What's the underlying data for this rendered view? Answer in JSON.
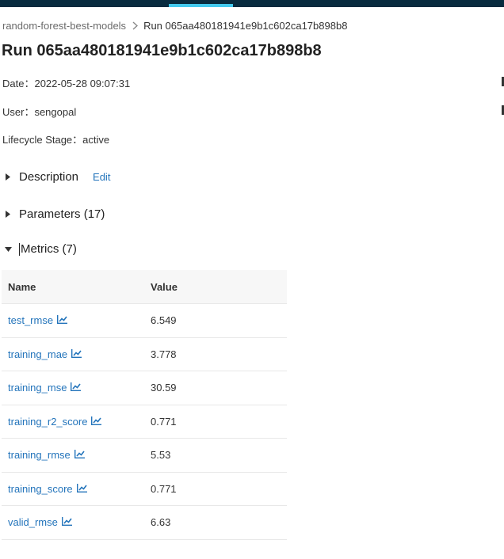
{
  "colors": {
    "topbar": "#082b3f",
    "active_tab_indicator": "#43c9ed",
    "link": "#2374bb"
  },
  "breadcrumb": {
    "parent": "random-forest-best-models",
    "separator_icon": "chevron-right-icon",
    "current": "Run 065aa480181941e9b1c602ca17b898b8"
  },
  "title": "Run 065aa480181941e9b1c602ca17b898b8",
  "meta": {
    "date_label": "Date：",
    "date_value": "2022-05-28 09:07:31",
    "user_label": "User：",
    "user_value": "sengopal",
    "stage_label": "Lifecycle Stage：",
    "stage_value": "active"
  },
  "sections": {
    "description": {
      "label": "Description",
      "edit": "Edit",
      "expanded": false
    },
    "parameters": {
      "label": "Parameters (17)",
      "expanded": false
    },
    "metrics": {
      "label": "Metrics (7)",
      "expanded": true
    }
  },
  "metrics_table": {
    "headers": {
      "name": "Name",
      "value": "Value"
    },
    "row_icon": "line-chart-icon",
    "rows": [
      {
        "name": "test_rmse",
        "value": "6.549"
      },
      {
        "name": "training_mae",
        "value": "3.778"
      },
      {
        "name": "training_mse",
        "value": "30.59"
      },
      {
        "name": "training_r2_score",
        "value": "0.771"
      },
      {
        "name": "training_rmse",
        "value": "5.53"
      },
      {
        "name": "training_score",
        "value": "0.771"
      },
      {
        "name": "valid_rmse",
        "value": "6.63"
      }
    ]
  }
}
